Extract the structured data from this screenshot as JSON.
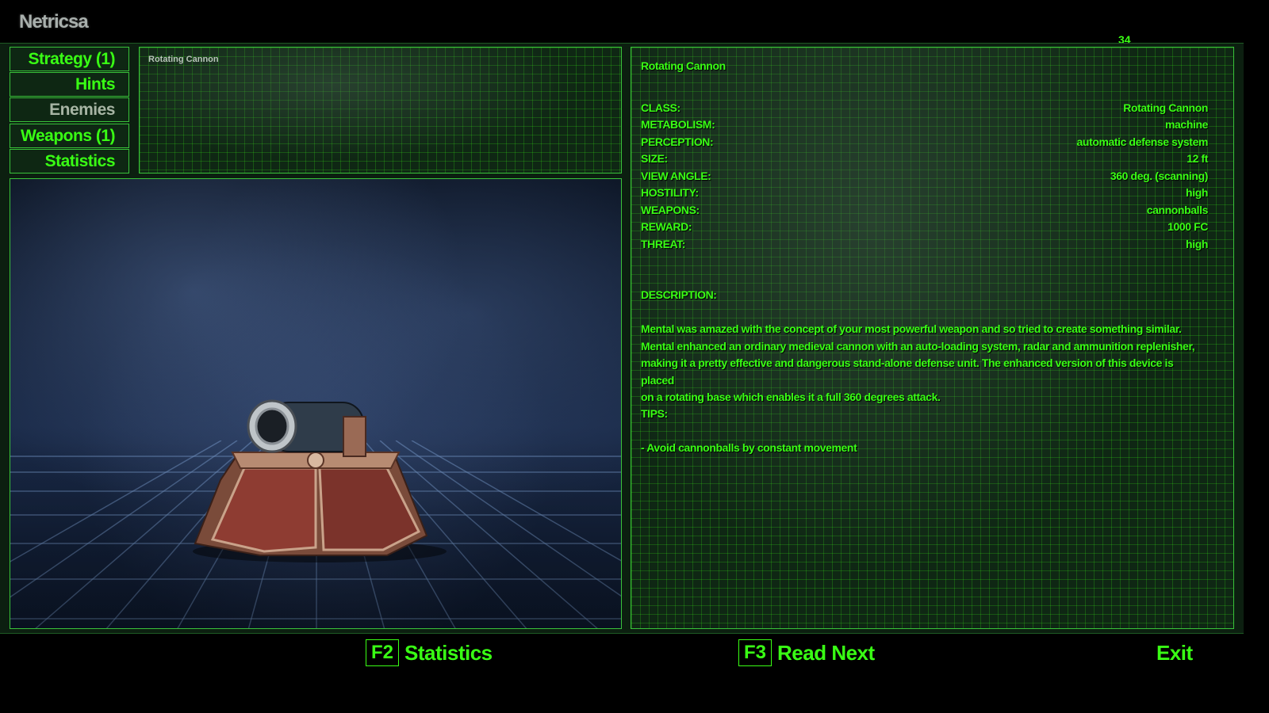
{
  "header": {
    "title": "Netricsa",
    "page_number": "34"
  },
  "menu": [
    {
      "label": "Strategy (1)",
      "state": "active"
    },
    {
      "label": "Hints",
      "state": "active"
    },
    {
      "label": "Enemies",
      "state": "inactive"
    },
    {
      "label": "Weapons (1)",
      "state": "active"
    },
    {
      "label": "Statistics",
      "state": "active"
    }
  ],
  "preview_box": {
    "label": "Rotating Cannon"
  },
  "info": {
    "title": "Rotating Cannon",
    "fields": [
      {
        "key": "CLASS:",
        "value": "Rotating Cannon"
      },
      {
        "key": "METABOLISM:",
        "value": "machine"
      },
      {
        "key": "PERCEPTION:",
        "value": "automatic defense system"
      },
      {
        "key": "SIZE:",
        "value": "12 ft"
      },
      {
        "key": "VIEW ANGLE:",
        "value": "360 deg. (scanning)"
      },
      {
        "key": "HOSTILITY:",
        "value": "high"
      },
      {
        "key": "WEAPONS:",
        "value": "cannonballs"
      },
      {
        "key": "REWARD:",
        "value": "1000 FC"
      },
      {
        "key": "THREAT:",
        "value": "high"
      }
    ],
    "description_label": "DESCRIPTION:",
    "description": [
      "Mental was amazed with the concept of your most powerful weapon and so tried to create something similar.",
      "Mental enhanced an ordinary medieval cannon with an auto-loading system, radar and ammunition replenisher,",
      "making it a pretty effective and dangerous stand-alone defense unit.  The enhanced version of this device is placed",
      "on a rotating base which enables it a full 360 degrees attack."
    ],
    "tips_label": "TIPS:",
    "tips": "- Avoid cannonballs by constant movement"
  },
  "bottom_bar": {
    "statistics": {
      "key": "F2",
      "label": "Statistics"
    },
    "read_next": {
      "key": "F3",
      "label": "Read Next"
    },
    "exit": {
      "label": "Exit"
    }
  },
  "colors": {
    "accent": "#39ff14",
    "inactive": "#a7b5a4",
    "frame": "#39c23a"
  }
}
